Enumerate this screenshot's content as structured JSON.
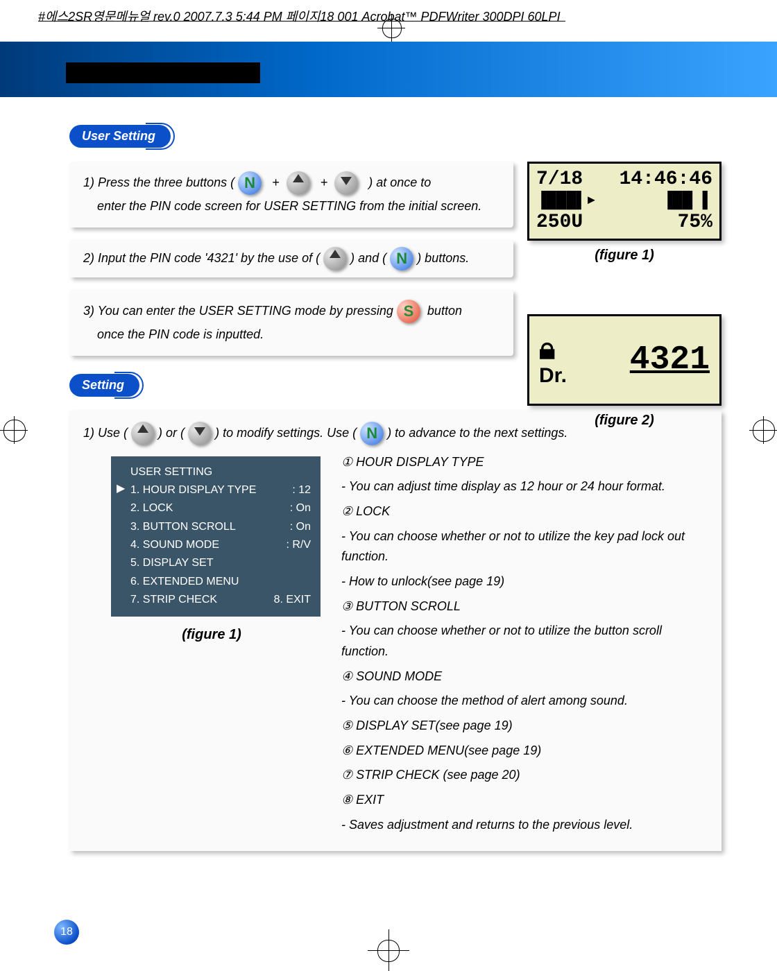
{
  "header_text": "#에스2SR영문메뉴얼 rev.0  2007.7.3 5:44 PM  페이지18   001 Acrobat™ PDFWriter 300DPI 60LPI",
  "pill_user_setting": "User Setting",
  "pill_setting": "Setting",
  "step1_pre": "1) Press the three buttons (",
  "step1_plus": "+",
  "step1_post": ") at once to",
  "step1_line2": "enter the PIN code screen for USER SETTING from the initial screen.",
  "step2_pre": "2) Input the PIN code '4321' by the use of (",
  "step2_mid": ") and (",
  "step2_post": ") buttons.",
  "step3_pre": "3) You can enter the USER SETTING mode by pressing",
  "step3_post": "button",
  "step3_line2": "once the PIN code is inputted.",
  "fig1_caption": "(figure 1)",
  "fig2_caption": "(figure 2)",
  "lcd1_date": "7/18",
  "lcd1_time": "14:46:46",
  "lcd1_units": "250U",
  "lcd1_pct": "75%",
  "lcd2_pin": "4321",
  "lcd2_dr": "Dr.",
  "setting_intro_pre": "1) Use (",
  "setting_intro_mid1": ") or (",
  "setting_intro_mid2": ") to modify settings. Use (",
  "setting_intro_post": ") to advance to the next settings.",
  "menu_title": "USER SETTING",
  "menu": [
    {
      "label": "1. HOUR DISPLAY TYPE",
      "val": ": 12"
    },
    {
      "label": "2. LOCK",
      "val": ": On"
    },
    {
      "label": "3. BUTTON SCROLL",
      "val": ": On"
    },
    {
      "label": "4. SOUND MODE",
      "val": ": R/V"
    },
    {
      "label": "5. DISPLAY SET",
      "val": ""
    },
    {
      "label": "6. EXTENDED MENU",
      "val": ""
    },
    {
      "label": "7. STRIP CHECK",
      "val": "8. EXIT"
    }
  ],
  "menu_fig_caption": "(figure 1)",
  "desc": {
    "d1_title": "① HOUR DISPLAY TYPE",
    "d1_1": "-   You can adjust time display as 12 hour or 24 hour format.",
    "d2_title": "②  LOCK",
    "d2_1": " -   You can choose whether or not to utilize the key pad lock out function.",
    "d2_2": "-   How to unlock(see page 19)",
    "d3_title": "③ BUTTON SCROLL",
    "d3_1": " -   You can choose whether or not to utilize the button scroll function.",
    "d4_title": "④ SOUND MODE",
    "d4_1": " -   You can choose the method of alert among sound.",
    "d5_title": "⑤ DISPLAY SET(see page 19)",
    "d6_title": "⑥ EXTENDED MENU(see page 19)",
    "d7_title": "⑦ STRIP CHECK (see page 20)",
    "d8_title": "⑧  EXIT",
    "d8_1": "-   Saves adjustment and returns to the previous level."
  },
  "page_number": "18"
}
